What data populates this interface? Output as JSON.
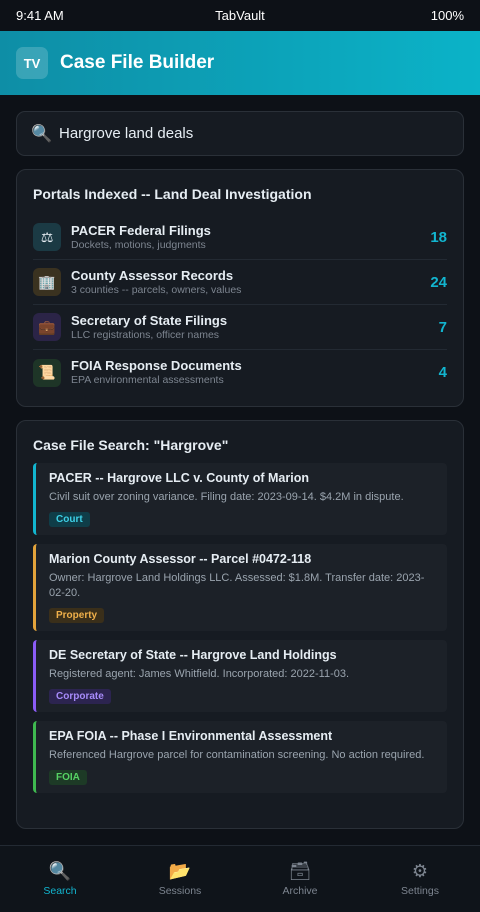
{
  "status_bar": {
    "time": "9:41 AM",
    "app_name": "TabVault",
    "battery": "100%"
  },
  "header": {
    "logo_text": "TV",
    "title": "Case File Builder"
  },
  "search": {
    "icon": "magnifier-icon",
    "value": "Hargrove land deals"
  },
  "portals": {
    "title": "Portals Indexed -- Land Deal Investigation",
    "items": [
      {
        "name": "PACER Federal Filings",
        "subtitle": "Dockets, motions, judgments",
        "count": "18",
        "icon": "scales-icon",
        "glyph": "⚖",
        "icon_bg": "#1b3a44"
      },
      {
        "name": "County Assessor Records",
        "subtitle": "3 counties -- parcels, owners, values",
        "count": "24",
        "icon": "building-icon",
        "glyph": "🏢",
        "icon_bg": "#3a3220"
      },
      {
        "name": "Secretary of State Filings",
        "subtitle": "LLC registrations, officer names",
        "count": "7",
        "icon": "briefcase-icon",
        "glyph": "💼",
        "icon_bg": "#2b2447"
      },
      {
        "name": "FOIA Response Documents",
        "subtitle": "EPA environmental assessments",
        "count": "4",
        "icon": "scroll-icon",
        "glyph": "📜",
        "icon_bg": "#1e3527"
      }
    ]
  },
  "results": {
    "title": "Case File Search: \"Hargrove\"",
    "items": [
      {
        "title": "PACER -- Hargrove LLC v. County of Marion",
        "desc": "Civil suit over zoning variance. Filing date: 2023-09-14. $4.2M in dispute.",
        "tag": "Court",
        "accent": "#12b5cf",
        "tag_bg": "#0f3d48",
        "tag_color": "#3ed0e6"
      },
      {
        "title": "Marion County Assessor -- Parcel #0472-118",
        "desc": "Owner: Hargrove Land Holdings LLC. Assessed: $1.8M. Transfer date: 2023-02-20.",
        "tag": "Property",
        "accent": "#e3a33b",
        "tag_bg": "#3a2f1a",
        "tag_color": "#f0b04a"
      },
      {
        "title": "DE Secretary of State -- Hargrove Land Holdings",
        "desc": "Registered agent: James Whitfield. Incorporated: 2022-11-03.",
        "tag": "Corporate",
        "accent": "#8b5cf6",
        "tag_bg": "#2c2450",
        "tag_color": "#a78bfa"
      },
      {
        "title": "EPA FOIA -- Phase I Environmental Assessment",
        "desc": "Referenced Hargrove parcel for contamination screening. No action required.",
        "tag": "FOIA",
        "accent": "#3fb950",
        "tag_bg": "#1d3a26",
        "tag_color": "#56d364"
      }
    ]
  },
  "nav": {
    "items": [
      {
        "label": "Search",
        "icon": "magnifier-icon",
        "glyph": "🔍",
        "active": true
      },
      {
        "label": "Sessions",
        "icon": "folder-icon",
        "glyph": "📂",
        "active": false
      },
      {
        "label": "Archive",
        "icon": "file-box-icon",
        "glyph": "🗃",
        "active": false
      },
      {
        "label": "Settings",
        "icon": "gear-icon",
        "glyph": "⚙",
        "active": false
      }
    ]
  }
}
